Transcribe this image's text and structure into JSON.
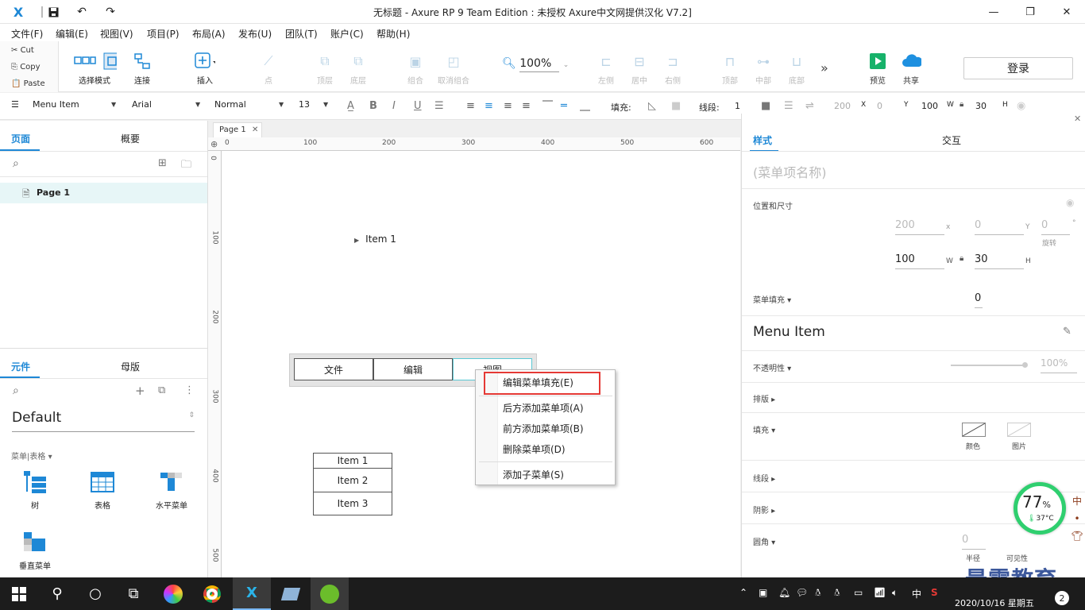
{
  "titlebar": {
    "title": "无标题 - Axure RP 9 Team Edition : 未授权     Axure中文网提供汉化 V7.2]"
  },
  "menubar": {
    "items": [
      "文件(F)",
      "编辑(E)",
      "视图(V)",
      "项目(P)",
      "布局(A)",
      "发布(U)",
      "团队(T)",
      "账户(C)",
      "帮助(H)"
    ]
  },
  "clipboard": {
    "cut": "Cut",
    "copy": "Copy",
    "paste": "Paste"
  },
  "toolbar": {
    "select_mode": "选择模式",
    "connect": "连接",
    "insert": "插入",
    "point": "点",
    "top": "顶层",
    "bottom": "底层",
    "group": "组合",
    "ungroup": "取消组合",
    "zoom": "100%",
    "align_left": "左侧",
    "align_center": "居中",
    "align_right": "右侧",
    "align_top": "顶部",
    "align_middle": "中部",
    "align_bottom": "底部",
    "preview": "预览",
    "share": "共享",
    "login": "登录"
  },
  "format": {
    "widget_type": "Menu Item",
    "font": "Arial",
    "weight": "Normal",
    "size": "13",
    "fill_label": "填充:",
    "line_label": "线段:",
    "line_value": "1",
    "x": "200",
    "x_label": "X",
    "y": "0",
    "y_label": "Y",
    "w": "100",
    "w_label": "W",
    "h": "30",
    "h_label": "H"
  },
  "left": {
    "pages_tab": "页面",
    "outline_tab": "概要",
    "page_name": "Page 1",
    "widgets_tab": "元件",
    "masters_tab": "母版",
    "library": "Default",
    "category": "菜单|表格",
    "widgets": [
      "树",
      "表格",
      "水平菜单",
      "垂直菜单"
    ]
  },
  "canvas": {
    "page_tab": "Page 1",
    "ruler_h": [
      "0",
      "100",
      "200",
      "300",
      "400",
      "500",
      "600"
    ],
    "ruler_v": [
      "0",
      "100",
      "200",
      "300",
      "400",
      "500"
    ],
    "tree_item": "Item 1",
    "hmenu": [
      "文件",
      "编辑",
      "视图"
    ],
    "vmenu": [
      "Item 1",
      "Item 2",
      "Item 3"
    ]
  },
  "context_menu": {
    "items": [
      "编辑菜单填充(E)",
      "后方添加菜单项(A)",
      "前方添加菜单项(B)",
      "删除菜单项(D)",
      "添加子菜单(S)"
    ]
  },
  "right": {
    "style_tab": "样式",
    "interact_tab": "交互",
    "name_placeholder": "(菜单项名称)",
    "pos_size": "位置和尺寸",
    "x": "200",
    "x_label": "x",
    "y": "0",
    "y_label": "Y",
    "rot": "0",
    "rot_unit": "°",
    "rot_label": "旋转",
    "w": "100",
    "w_label": "W",
    "h": "30",
    "h_label": "H",
    "menu_fill": "菜单填充 ▾",
    "menu_fill_value": "0",
    "widget_type": "Menu Item",
    "opacity": "不透明性 ▾",
    "opacity_value": "100%",
    "layout": "排版 ▸",
    "fill": "填充 ▾",
    "fill_color": "颜色",
    "fill_image": "图片",
    "border": "线段 ▸",
    "shadow": "阴影 ▸",
    "corner": "圆角 ▾",
    "corner_value": "0",
    "corner_radius": "半径",
    "corner_visible": "可见性"
  },
  "overlay": {
    "temp_percent": "77",
    "temp_unit": "%",
    "temp_c": "37°C",
    "brand": "最需教育"
  },
  "taskbar": {
    "date": "2020/10/16 星期五",
    "ime": "中",
    "badge": "2"
  },
  "colors": {
    "accent": "#1e88d6",
    "highlight": "#e53935",
    "selection": "#5bc8d4"
  }
}
